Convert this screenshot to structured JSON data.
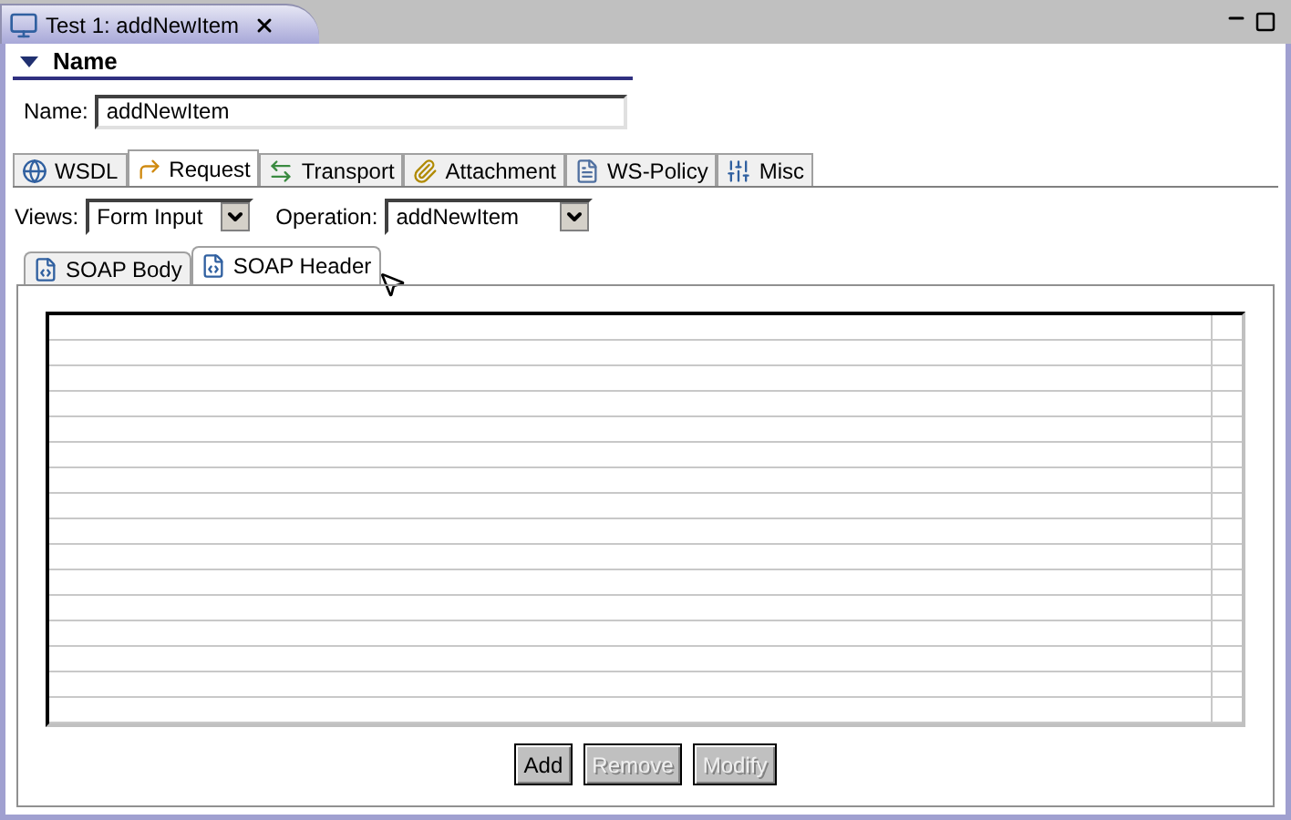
{
  "editor_tab": {
    "title": "Test 1: addNewItem"
  },
  "section": {
    "title": "Name",
    "expanded": true
  },
  "name_field": {
    "label": "Name:",
    "value": "addNewItem"
  },
  "tabs": [
    {
      "label": "WSDL",
      "selected": false
    },
    {
      "label": "Request",
      "selected": true
    },
    {
      "label": "Transport",
      "selected": false
    },
    {
      "label": "Attachment",
      "selected": false
    },
    {
      "label": "WS-Policy",
      "selected": false
    },
    {
      "label": "Misc",
      "selected": false
    }
  ],
  "views": {
    "label": "Views:",
    "value": "Form Input"
  },
  "operation": {
    "label": "Operation:",
    "value": "addNewItem"
  },
  "subtabs": [
    {
      "label": "SOAP Body",
      "selected": false
    },
    {
      "label": "SOAP Header",
      "selected": true
    }
  ],
  "buttons": [
    {
      "label": "Add",
      "disabled": false
    },
    {
      "label": "Remove",
      "disabled": true
    },
    {
      "label": "Modify",
      "disabled": true
    }
  ]
}
